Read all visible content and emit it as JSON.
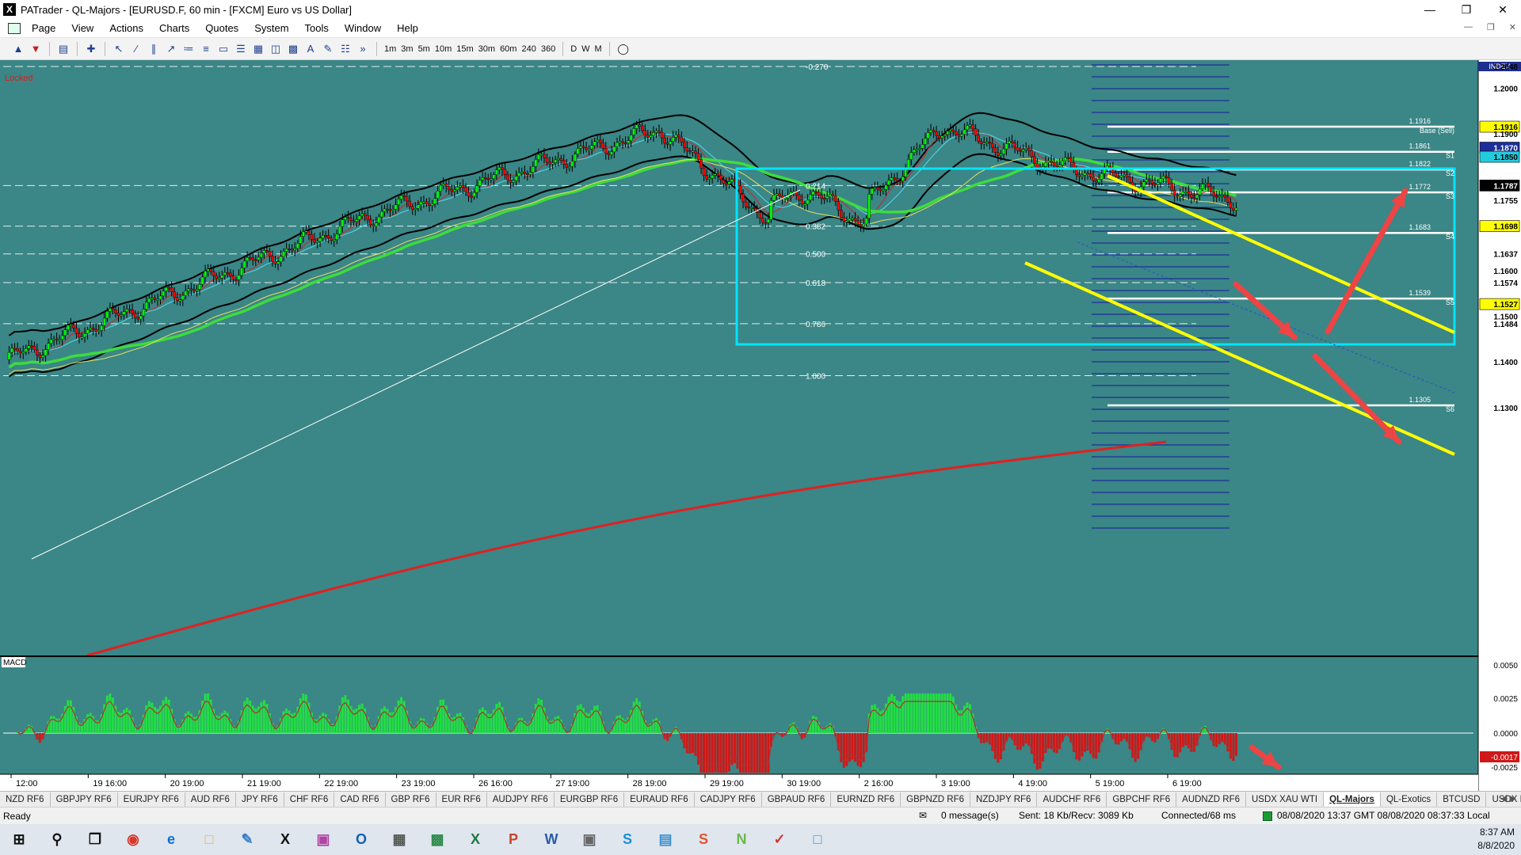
{
  "window": {
    "title": "PATrader - QL-Majors - [EURUSD.F, 60 min - [FXCM] Euro vs US Dollar]",
    "app_icon_label": "X"
  },
  "menu": [
    "Page",
    "View",
    "Actions",
    "Charts",
    "Quotes",
    "System",
    "Tools",
    "Window",
    "Help"
  ],
  "toolbar": {
    "timeframes": [
      "1m",
      "3m",
      "5m",
      "10m",
      "15m",
      "30m",
      "60m",
      "240",
      "360"
    ],
    "periods": [
      "D",
      "W",
      "M"
    ]
  },
  "chart": {
    "locked_label": "Locked",
    "index_label": "INDEX",
    "price_axis_labels": [
      "1.2048",
      "1.2000",
      "1.1916",
      "1.1900",
      "1.1870",
      "1.1850",
      "1.1787",
      "1.1755",
      "1.1698",
      "1.1637",
      "1.1600",
      "1.1574",
      "1.1527",
      "1.1500",
      "1.1484",
      "1.1400",
      "1.1300"
    ],
    "fib_levels": [
      {
        "label": "-0.270",
        "price": 1.2048
      },
      {
        "label": "0.214",
        "price": 1.1787
      },
      {
        "label": "0.382",
        "price": 1.1698
      },
      {
        "label": "0.500",
        "price": 1.1637
      },
      {
        "label": "0.618",
        "price": 1.1574
      },
      {
        "label": "0.786",
        "price": 1.1484
      },
      {
        "label": "1.000",
        "price": 1.137
      }
    ],
    "pivot_levels": [
      {
        "name": "Base (Sell)",
        "value": "1.1916",
        "price": 1.1916
      },
      {
        "name": "S1",
        "value": "1.1861",
        "price": 1.1861
      },
      {
        "name": "S2",
        "value": "1.1822",
        "price": 1.1822
      },
      {
        "name": "S3",
        "value": "1.1772",
        "price": 1.1772
      },
      {
        "name": "S4",
        "value": "1.1683",
        "price": 1.1683
      },
      {
        "name": "S5",
        "value": "1.1539",
        "price": 1.1539
      },
      {
        "name": "S6",
        "value": "1.1305",
        "price": 1.1305
      }
    ],
    "macd": {
      "label": "MACD",
      "axis_labels": [
        "0.0050",
        "0.0025",
        "0.0000",
        "-0.0025"
      ],
      "current_value": "-0.0017"
    },
    "time_labels": [
      "12:00",
      "19 16:00",
      "20 19:00",
      "21 19:00",
      "22 19:00",
      "23 19:00",
      "26 16:00",
      "27 19:00",
      "28 19:00",
      "29 19:00",
      "30 19:00",
      "2 16:00",
      "3 19:00",
      "4 19:00",
      "5 19:00",
      "6 19:00"
    ],
    "colors": {
      "background": "#3b8686",
      "bull_candle": "#00ff00",
      "bear_candle": "#ff0000",
      "yellow_channel": "#ffff00",
      "box": "#00e5ff",
      "sma": "#3ddc3d",
      "long_ma": "#e02020",
      "arrows": "#ee4444"
    }
  },
  "symbol_tabs": [
    "NZD RF6",
    "GBPJPY RF6",
    "EURJPY RF6",
    "AUD RF6",
    "JPY RF6",
    "CHF RF6",
    "CAD RF6",
    "GBP RF6",
    "EUR RF6",
    "AUDJPY RF6",
    "EURGBP RF6",
    "EURAUD RF6",
    "CADJPY RF6",
    "GBPAUD RF6",
    "EURNZD RF6",
    "GBPNZD RF6",
    "NZDJPY RF6",
    "AUDCHF RF6",
    "GBPCHF RF6",
    "AUDNZD RF6",
    "USDX XAU WTI",
    "QL-Majors",
    "QL-Exotics",
    "BTCUSD",
    "USDX RF6"
  ],
  "active_tab": "QL-Majors",
  "status": {
    "ready": "Ready",
    "messages": "0 message(s)",
    "traffic": "Sent: 18 Kb/Recv: 3089 Kb",
    "connection": "Connected/68 ms",
    "datetime": "08/08/2020 13:37 GMT   08/08/2020 08:37:33 Local"
  },
  "taskbar": {
    "time": "8:37 AM",
    "date": "8/8/2020"
  }
}
